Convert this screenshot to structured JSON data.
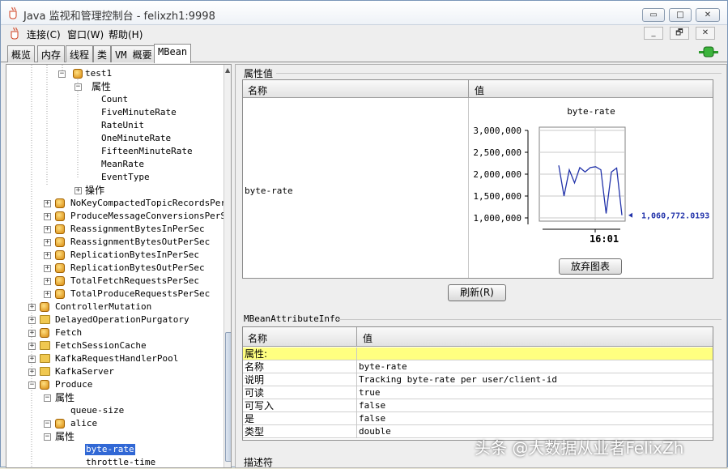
{
  "window": {
    "title": "Java 监视和管理控制台 - felixzh1:9998",
    "controls": [
      "▭",
      "□",
      "✕"
    ],
    "inner_controls": [
      "_",
      "🗗",
      "✕"
    ]
  },
  "menu": [
    "连接(C)",
    "窗口(W)",
    "帮助(H)"
  ],
  "tabs": [
    "概览",
    "内存",
    "线程",
    "类",
    "VM 概要",
    "MBean"
  ],
  "active_tab": "MBean",
  "tree": {
    "nodes": [
      {
        "label": "test1",
        "kind": "bean"
      },
      {
        "label": "属性",
        "kind": "group"
      },
      {
        "label": "Count",
        "kind": "leaf"
      },
      {
        "label": "FiveMinuteRate",
        "kind": "leaf"
      },
      {
        "label": "RateUnit",
        "kind": "leaf"
      },
      {
        "label": "OneMinuteRate",
        "kind": "leaf"
      },
      {
        "label": "FifteenMinuteRate",
        "kind": "leaf"
      },
      {
        "label": "MeanRate",
        "kind": "leaf"
      },
      {
        "label": "EventType",
        "kind": "leaf"
      },
      {
        "label": "操作",
        "kind": "group"
      },
      {
        "label": "NoKeyCompactedTopicRecordsPerSec",
        "kind": "bean"
      },
      {
        "label": "ProduceMessageConversionsPerSec",
        "kind": "bean"
      },
      {
        "label": "ReassignmentBytesInPerSec",
        "kind": "bean"
      },
      {
        "label": "ReassignmentBytesOutPerSec",
        "kind": "bean"
      },
      {
        "label": "ReplicationBytesInPerSec",
        "kind": "bean"
      },
      {
        "label": "ReplicationBytesOutPerSec",
        "kind": "bean"
      },
      {
        "label": "TotalFetchRequestsPerSec",
        "kind": "bean"
      },
      {
        "label": "TotalProduceRequestsPerSec",
        "kind": "bean"
      },
      {
        "label": "ControllerMutation",
        "kind": "bean"
      },
      {
        "label": "DelayedOperationPurgatory",
        "kind": "folder"
      },
      {
        "label": "Fetch",
        "kind": "bean"
      },
      {
        "label": "FetchSessionCache",
        "kind": "folder"
      },
      {
        "label": "KafkaRequestHandlerPool",
        "kind": "folder"
      },
      {
        "label": "KafkaServer",
        "kind": "folder"
      },
      {
        "label": "Produce",
        "kind": "bean"
      },
      {
        "label": "属性",
        "kind": "group"
      },
      {
        "label": "queue-size",
        "kind": "leaf"
      },
      {
        "label": "alice",
        "kind": "bean"
      },
      {
        "label": "属性",
        "kind": "group"
      },
      {
        "label": "byte-rate",
        "kind": "leaf",
        "selected": true
      },
      {
        "label": "throttle-time",
        "kind": "leaf"
      }
    ]
  },
  "attr_values": {
    "section_title": "属性值",
    "col_name": "名称",
    "col_value": "值",
    "row_name": "byte-rate",
    "refresh_button": "刷新(R)",
    "discard_chart_button": "放弃图表"
  },
  "chart_data": {
    "type": "line",
    "title": "byte-rate",
    "y_ticks": [
      "3,000,000",
      "2,500,000",
      "2,000,000",
      "1,500,000",
      "1,000,000"
    ],
    "ylim": [
      1000000,
      3000000
    ],
    "x_tick": "16:01",
    "series": [
      {
        "values": [
          2200000,
          1500000,
          2100000,
          1800000,
          2150000,
          2050000,
          2150000,
          2170000,
          2100000,
          1100000,
          2050000,
          2140000,
          1060772
        ]
      }
    ],
    "current_value_label": "1,060,772.0193",
    "line_color": "#2233aa"
  },
  "info": {
    "section_title": "MBeanAttributeInfo",
    "col_name": "名称",
    "col_value": "值",
    "rows": [
      {
        "name": "属性:",
        "value": "",
        "highlight": true
      },
      {
        "name": "名称",
        "value": "byte-rate"
      },
      {
        "name": "说明",
        "value": "Tracking byte-rate per user/client-id"
      },
      {
        "name": "可读",
        "value": "true"
      },
      {
        "name": "可写入",
        "value": "false"
      },
      {
        "name": "是",
        "value": "false"
      },
      {
        "name": "类型",
        "value": "double"
      }
    ]
  },
  "descriptor": {
    "section_title": "描述符"
  },
  "watermark": "头条 @大数据从业者FelixZh"
}
